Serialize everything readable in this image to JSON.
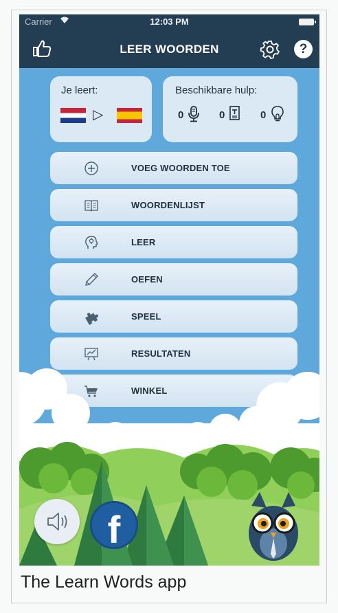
{
  "status_bar": {
    "carrier": "Carrier",
    "time": "12:03 PM"
  },
  "header": {
    "title": "LEER WOORDEN",
    "help_label": "?"
  },
  "learn_card": {
    "label": "Je leert:",
    "arrow": "▷"
  },
  "help_card": {
    "label": "Beschikbare hulp:",
    "items": [
      {
        "count": "0",
        "icon": "microphone-icon"
      },
      {
        "count": "0",
        "icon": "document-icon"
      },
      {
        "count": "0",
        "icon": "lightbulb-icon"
      }
    ]
  },
  "menu": [
    {
      "label": "VOEG WOORDEN TOE",
      "icon": "plus-circle-icon"
    },
    {
      "label": "WOORDENLIJST",
      "icon": "book-icon"
    },
    {
      "label": "LEER",
      "icon": "head-brain-icon"
    },
    {
      "label": "OEFEN",
      "icon": "pencil-icon"
    },
    {
      "label": "SPEEL",
      "icon": "puzzle-icon"
    },
    {
      "label": "RESULTATEN",
      "icon": "chart-board-icon"
    },
    {
      "label": "WINKEL",
      "icon": "cart-icon"
    }
  ],
  "footer": {
    "facebook_label": "f"
  },
  "caption": "The Learn Words app",
  "colors": {
    "header": "#233d52",
    "sky": "#5fa8dc",
    "card": "#dbe9f5",
    "facebook": "#1f5fa1"
  }
}
